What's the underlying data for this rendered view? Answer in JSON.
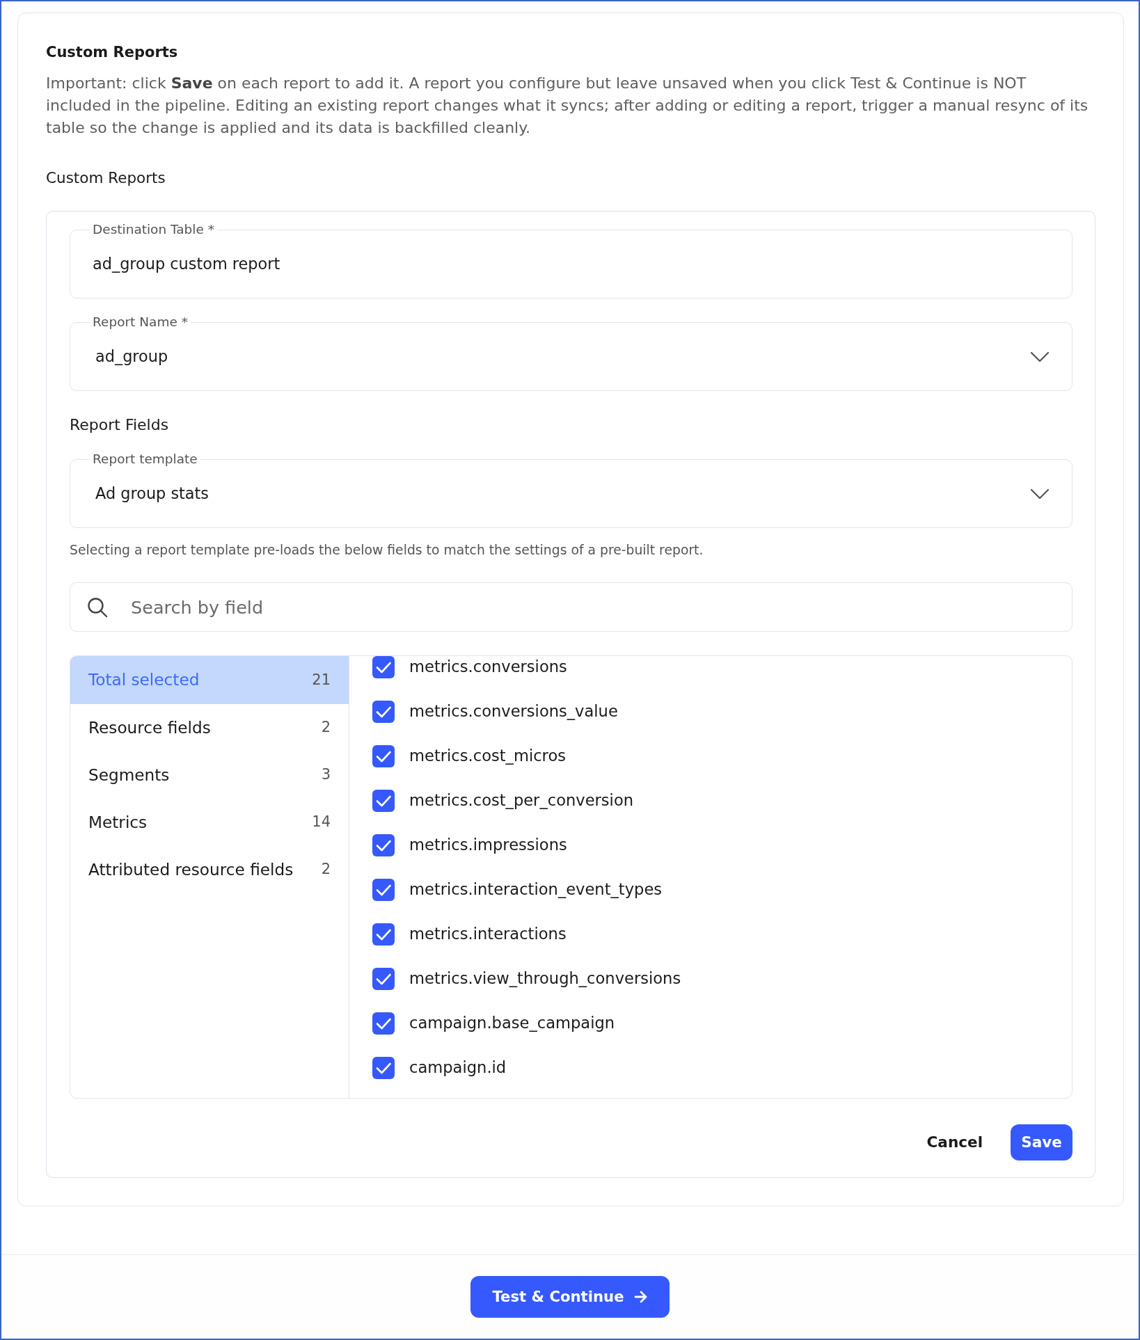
{
  "section": {
    "title": "Custom Reports",
    "description": "Important: click **Save** on each report to add it. A report you configure but leave unsaved when you click Test & Continue is NOT included in the pipeline. Editing an existing report changes what it syncs; after adding or editing a report, trigger a manual resync of its table so the change is applied and its data is backfilled cleanly.",
    "label": "Custom Reports"
  },
  "inputs": [
    {
      "kind": "text",
      "label": "Destination Table *",
      "value": "ad_group custom report"
    },
    {
      "kind": "dropdown",
      "label": "Report Name *",
      "value": "ad_group"
    }
  ],
  "report_fields": {
    "heading": "Report Fields",
    "template": {
      "kind": "dropdown",
      "label": "Report template",
      "value": "Ad group stats"
    },
    "hint": "Selecting a report template pre-loads the below fields to match the settings of a pre-built report.",
    "search": {
      "placeholder": "Search by field"
    },
    "categories": [
      {
        "label": "Total selected",
        "count": "21",
        "selected": true
      },
      {
        "label": "Resource fields",
        "count": "2",
        "selected": false
      },
      {
        "label": "Segments",
        "count": "3",
        "selected": false
      },
      {
        "label": "Metrics",
        "count": "14",
        "selected": false
      },
      {
        "label": "Attributed resource fields",
        "count": "2",
        "selected": false
      }
    ],
    "fields": [
      {
        "name": "metrics.conversions",
        "checked": true
      },
      {
        "name": "metrics.conversions_value",
        "checked": true
      },
      {
        "name": "metrics.cost_micros",
        "checked": true
      },
      {
        "name": "metrics.cost_per_conversion",
        "checked": true
      },
      {
        "name": "metrics.impressions",
        "checked": true
      },
      {
        "name": "metrics.interaction_event_types",
        "checked": true
      },
      {
        "name": "metrics.interactions",
        "checked": true
      },
      {
        "name": "metrics.view_through_conversions",
        "checked": true
      },
      {
        "name": "campaign.base_campaign",
        "checked": true
      },
      {
        "name": "campaign.id",
        "checked": true
      }
    ]
  },
  "actions": [
    {
      "kind": "text",
      "label": "Cancel"
    },
    {
      "kind": "primary",
      "label": "Save"
    }
  ],
  "footer": {
    "button": {
      "label": "Test & Continue"
    }
  }
}
